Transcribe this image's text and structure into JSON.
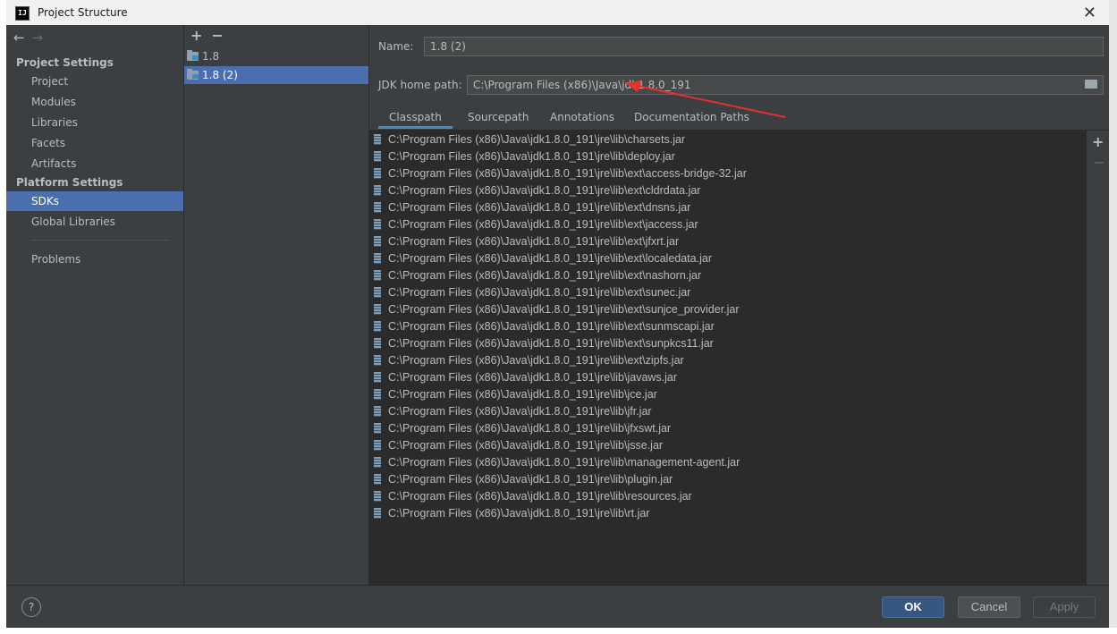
{
  "window": {
    "title": "Project Structure"
  },
  "nav": {
    "project_settings_header": "Project Settings",
    "project_items": [
      "Project",
      "Modules",
      "Libraries",
      "Facets",
      "Artifacts"
    ],
    "platform_settings_header": "Platform Settings",
    "platform_items": [
      "SDKs",
      "Global Libraries"
    ],
    "problems": "Problems",
    "selected": "SDKs"
  },
  "sdk_list": {
    "items": [
      "1.8",
      "1.8 (2)"
    ],
    "selected": "1.8 (2)"
  },
  "detail": {
    "name_label": "Name:",
    "name_value": "1.8 (2)",
    "home_label": "JDK home path:",
    "home_value": "C:\\Program Files (x86)\\Java\\jdk1.8.0_191",
    "tabs": [
      "Classpath",
      "Sourcepath",
      "Annotations",
      "Documentation Paths"
    ],
    "active_tab": "Classpath",
    "classpath": [
      "C:\\Program Files (x86)\\Java\\jdk1.8.0_191\\jre\\lib\\charsets.jar",
      "C:\\Program Files (x86)\\Java\\jdk1.8.0_191\\jre\\lib\\deploy.jar",
      "C:\\Program Files (x86)\\Java\\jdk1.8.0_191\\jre\\lib\\ext\\access-bridge-32.jar",
      "C:\\Program Files (x86)\\Java\\jdk1.8.0_191\\jre\\lib\\ext\\cldrdata.jar",
      "C:\\Program Files (x86)\\Java\\jdk1.8.0_191\\jre\\lib\\ext\\dnsns.jar",
      "C:\\Program Files (x86)\\Java\\jdk1.8.0_191\\jre\\lib\\ext\\jaccess.jar",
      "C:\\Program Files (x86)\\Java\\jdk1.8.0_191\\jre\\lib\\ext\\jfxrt.jar",
      "C:\\Program Files (x86)\\Java\\jdk1.8.0_191\\jre\\lib\\ext\\localedata.jar",
      "C:\\Program Files (x86)\\Java\\jdk1.8.0_191\\jre\\lib\\ext\\nashorn.jar",
      "C:\\Program Files (x86)\\Java\\jdk1.8.0_191\\jre\\lib\\ext\\sunec.jar",
      "C:\\Program Files (x86)\\Java\\jdk1.8.0_191\\jre\\lib\\ext\\sunjce_provider.jar",
      "C:\\Program Files (x86)\\Java\\jdk1.8.0_191\\jre\\lib\\ext\\sunmscapi.jar",
      "C:\\Program Files (x86)\\Java\\jdk1.8.0_191\\jre\\lib\\ext\\sunpkcs11.jar",
      "C:\\Program Files (x86)\\Java\\jdk1.8.0_191\\jre\\lib\\ext\\zipfs.jar",
      "C:\\Program Files (x86)\\Java\\jdk1.8.0_191\\jre\\lib\\javaws.jar",
      "C:\\Program Files (x86)\\Java\\jdk1.8.0_191\\jre\\lib\\jce.jar",
      "C:\\Program Files (x86)\\Java\\jdk1.8.0_191\\jre\\lib\\jfr.jar",
      "C:\\Program Files (x86)\\Java\\jdk1.8.0_191\\jre\\lib\\jfxswt.jar",
      "C:\\Program Files (x86)\\Java\\jdk1.8.0_191\\jre\\lib\\jsse.jar",
      "C:\\Program Files (x86)\\Java\\jdk1.8.0_191\\jre\\lib\\management-agent.jar",
      "C:\\Program Files (x86)\\Java\\jdk1.8.0_191\\jre\\lib\\plugin.jar",
      "C:\\Program Files (x86)\\Java\\jdk1.8.0_191\\jre\\lib\\resources.jar",
      "C:\\Program Files (x86)\\Java\\jdk1.8.0_191\\jre\\lib\\rt.jar"
    ]
  },
  "footer": {
    "help": "?",
    "ok": "OK",
    "cancel": "Cancel",
    "apply": "Apply"
  },
  "colors": {
    "selection": "#4b6eaf",
    "annotation_arrow": "#e8302a",
    "ok_button": "#365880"
  },
  "icons": {
    "back": "arrow-left",
    "forward": "arrow-right",
    "add": "plus",
    "remove": "minus",
    "sdk": "folder",
    "jar": "jar",
    "browse": "folder",
    "help": "question-mark",
    "close": "x"
  }
}
